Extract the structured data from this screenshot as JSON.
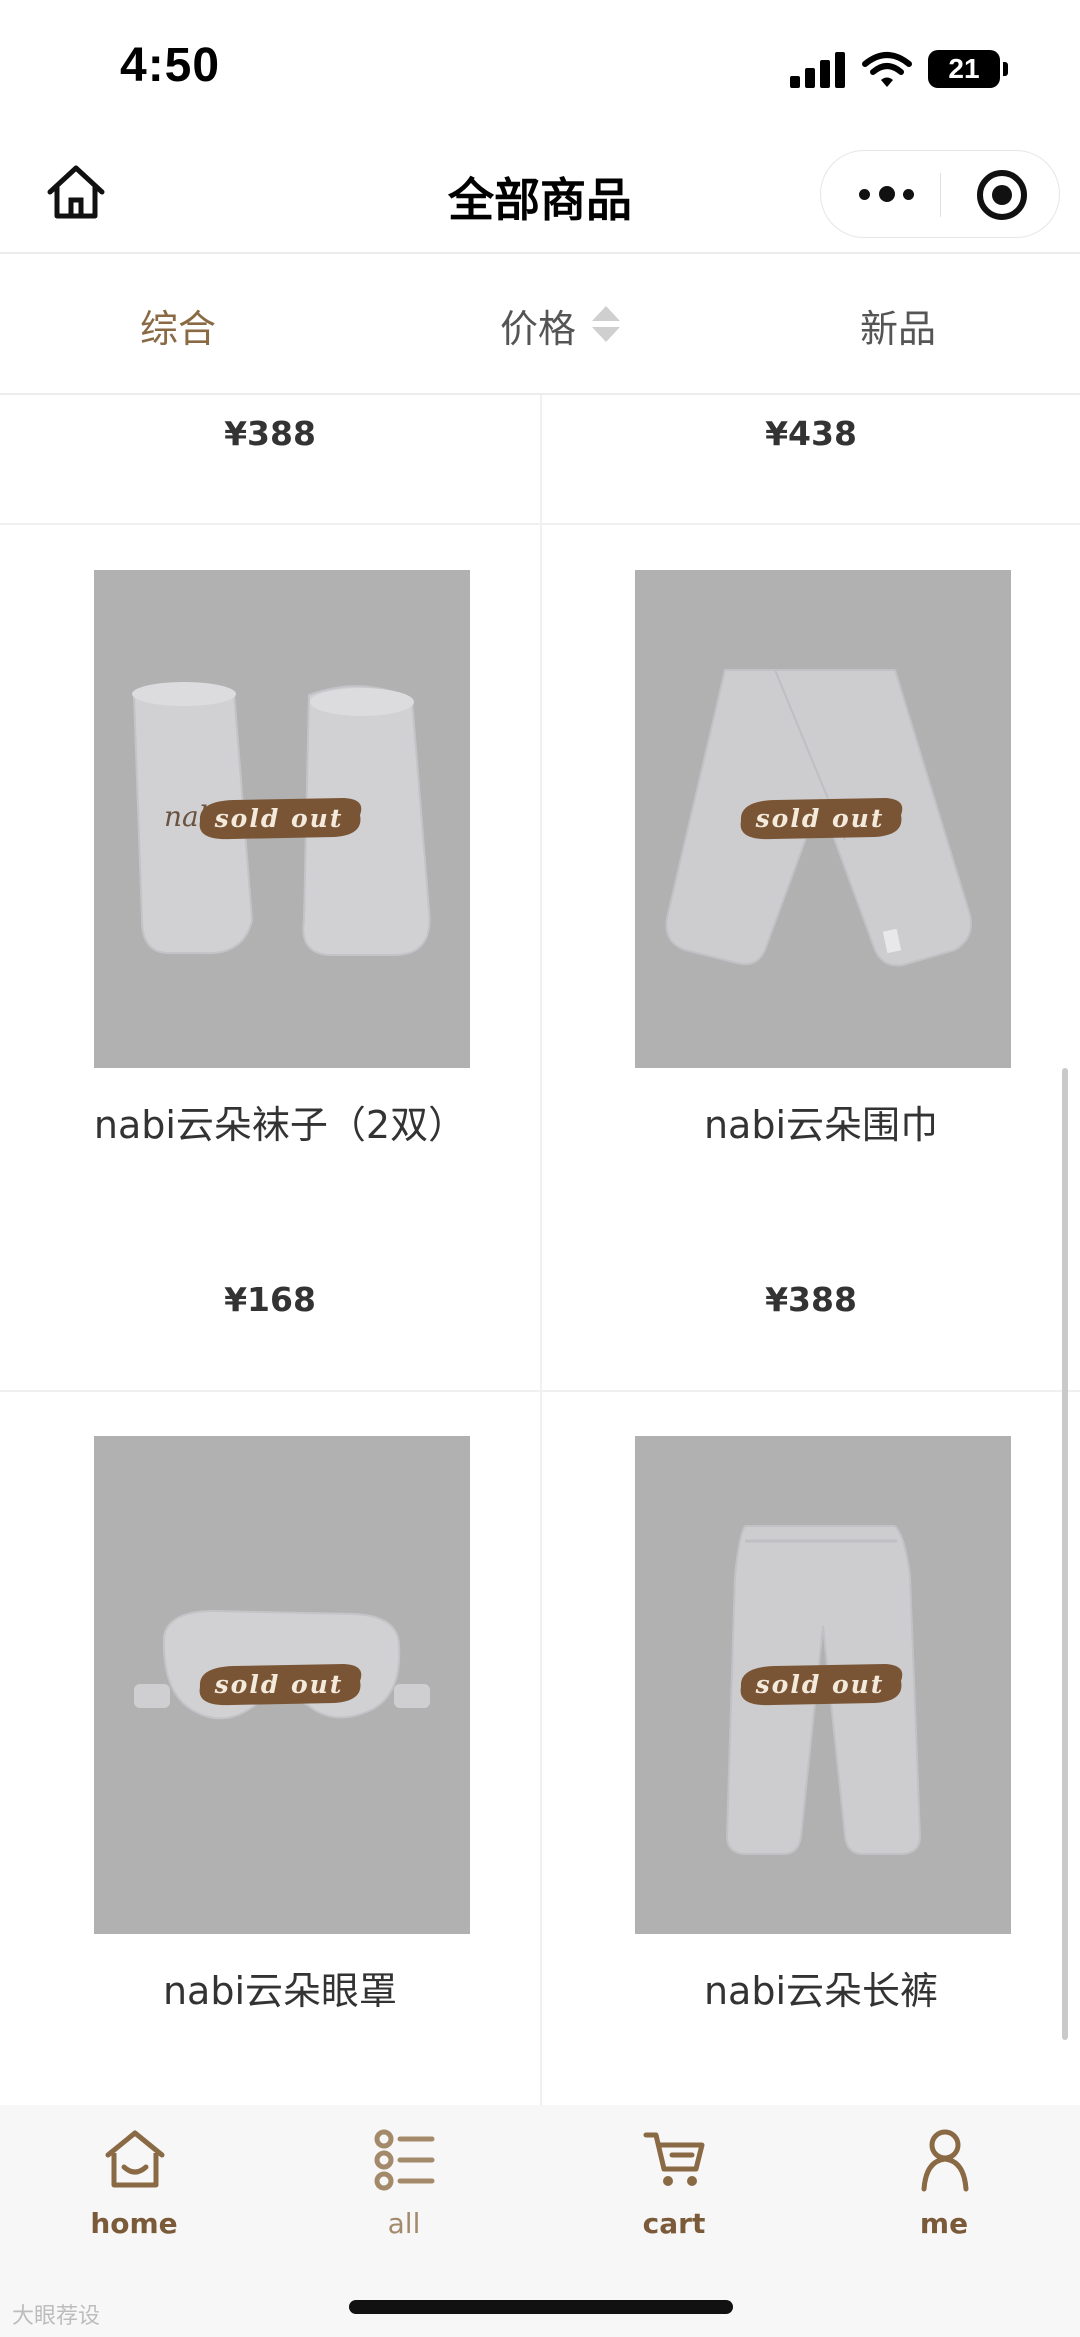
{
  "status_bar": {
    "time": "4:50",
    "battery": "21"
  },
  "nav": {
    "title": "全部商品"
  },
  "sort_tabs": {
    "comprehensive": "综合",
    "price": "价格",
    "new": "新品"
  },
  "top_prices": [
    "¥388",
    "¥438"
  ],
  "products": [
    {
      "name": "nabi云朵袜子（2双）",
      "price": "¥168",
      "badge": "sold out"
    },
    {
      "name": "nabi云朵围巾",
      "price": "¥388",
      "badge": "sold out"
    },
    {
      "name": "nabi云朵眼罩",
      "badge": "sold out"
    },
    {
      "name": "nabi云朵长裤",
      "badge": "sold out"
    }
  ],
  "tabbar": {
    "home": "home",
    "all": "all",
    "cart": "cart",
    "me": "me"
  },
  "watermark": "大眼荐设",
  "colors": {
    "accent": "#8a6a45",
    "image_bg": "#b1b1b1",
    "badge": "#7a5535"
  }
}
